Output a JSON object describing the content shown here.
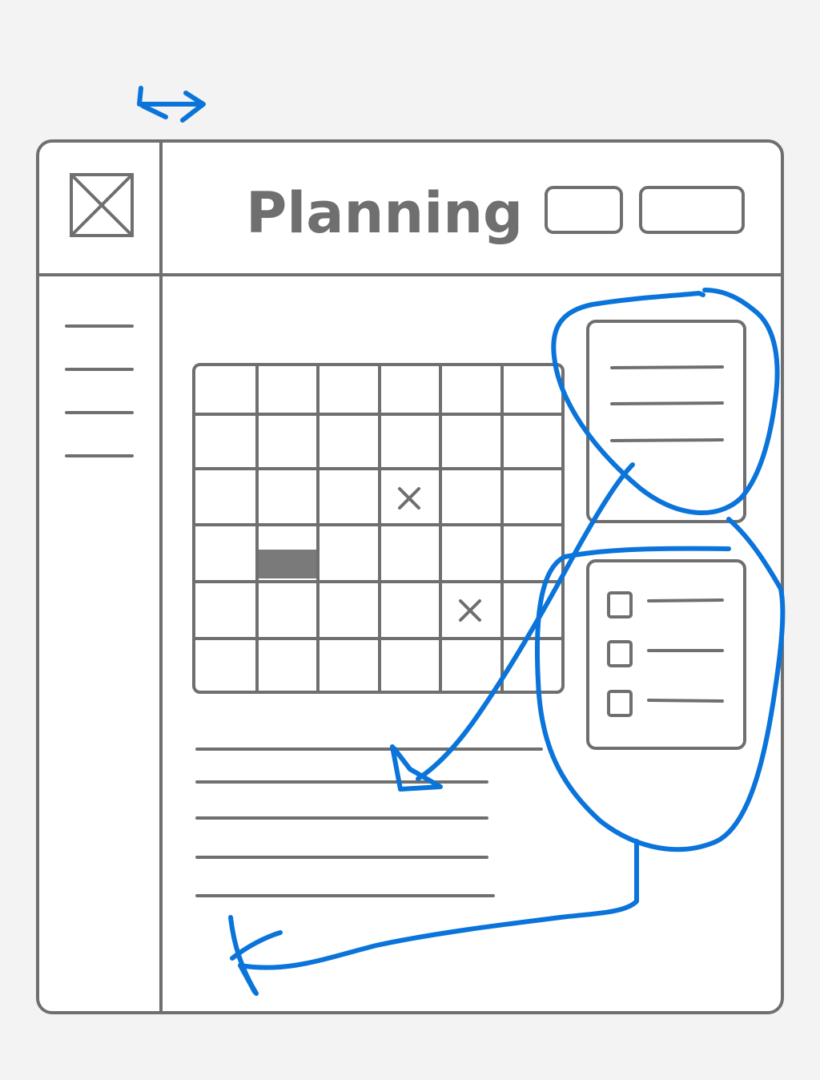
{
  "window": {
    "title": "Planning"
  },
  "header": {
    "logo": "image-placeholder-icon",
    "buttons": [
      {
        "name": "header-button-1",
        "label": ""
      },
      {
        "name": "header-button-2",
        "label": ""
      }
    ]
  },
  "sidebar": {
    "items": [
      "",
      "",
      "",
      ""
    ]
  },
  "calendar": {
    "rows": 6,
    "columns": 6,
    "marked_cells": [
      {
        "row": 2,
        "col": 3,
        "mark": "×"
      },
      {
        "row": 4,
        "col": 4,
        "mark": "×"
      }
    ],
    "selected_cell": {
      "row": 3,
      "col": 1
    }
  },
  "notes_card": {
    "lines": [
      "",
      "",
      ""
    ]
  },
  "checklist_card": {
    "items": [
      {
        "checked": false,
        "label": ""
      },
      {
        "checked": false,
        "label": ""
      },
      {
        "checked": false,
        "label": ""
      }
    ]
  },
  "text_block": {
    "lines": [
      "",
      "",
      "",
      "",
      ""
    ]
  },
  "annotations": {
    "color": "#0a74da",
    "items": [
      "resize-double-arrow",
      "notes-card-circle",
      "arrow-to-text-block",
      "checklist-circle",
      "arrow-to-bottom-left"
    ]
  },
  "colors": {
    "wireframe": "#6f6f6f",
    "accent": "#0a74da",
    "background": "#f3f3f3",
    "window": "#ffffff",
    "selected_cell": "#7a7a7a"
  }
}
